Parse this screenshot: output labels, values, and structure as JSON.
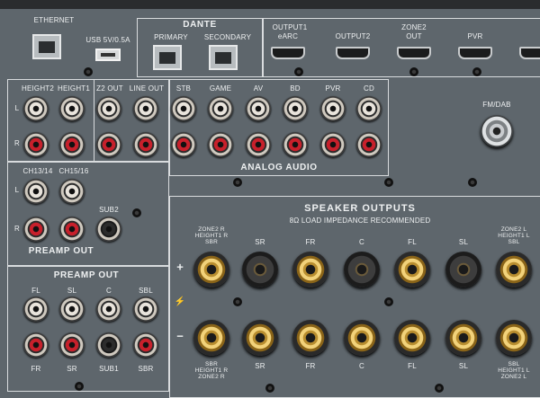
{
  "network": {
    "ethernet": "ETHERNET",
    "usb": "USB 5V/0.5A",
    "dante": "DANTE",
    "primary": "PRIMARY",
    "secondary": "SECONDARY"
  },
  "hdmi": {
    "output1": "OUTPUT1",
    "earc": "eARC",
    "output2": "OUTPUT2",
    "zone2": "ZONE2",
    "out": "OUT",
    "pvr": "PVR"
  },
  "preamp_top": {
    "height2": "HEIGHT2",
    "height1": "HEIGHT1",
    "z2out": "Z2 OUT",
    "lineout": "LINE OUT",
    "left": "L",
    "right": "R"
  },
  "analog": {
    "title": "ANALOG AUDIO",
    "inputs": [
      "STB",
      "GAME",
      "AV",
      "BD",
      "PVR",
      "CD"
    ]
  },
  "fm": "FM/DAB",
  "preamp_mid": {
    "ch1314": "CH13/14",
    "ch1516": "CH15/16",
    "sub2": "SUB2",
    "title": "PREAMP OUT"
  },
  "preamp_bottom": {
    "title": "PREAMP OUT",
    "top_labels": [
      "FL",
      "SL",
      "C",
      "SBL"
    ],
    "bottom_labels": [
      "FR",
      "SR",
      "SUB1",
      "SBR"
    ]
  },
  "speakers": {
    "title": "SPEAKER OUTPUTS",
    "subtitle": "8Ω LOAD IMPEDANCE RECOMMENDED",
    "plus": "+",
    "minus": "−",
    "top_labels": [
      "ZONE2 R\nHEIGHT1 R\nSBR",
      "SR",
      "FR",
      "C",
      "FL",
      "SL",
      "ZONE2 L\nHEIGHT1 L\nSBL"
    ],
    "bottom_labels": [
      "SBR\nHEIGHT1 R\nZONE2 R",
      "SR",
      "FR",
      "C",
      "FL",
      "SL",
      "SBL\nHEIGHT1 L\nZONE2 L"
    ]
  },
  "colors": {
    "panel": "#5e666c",
    "red_rca": "#c8202b",
    "gold": "#f2d27a"
  }
}
